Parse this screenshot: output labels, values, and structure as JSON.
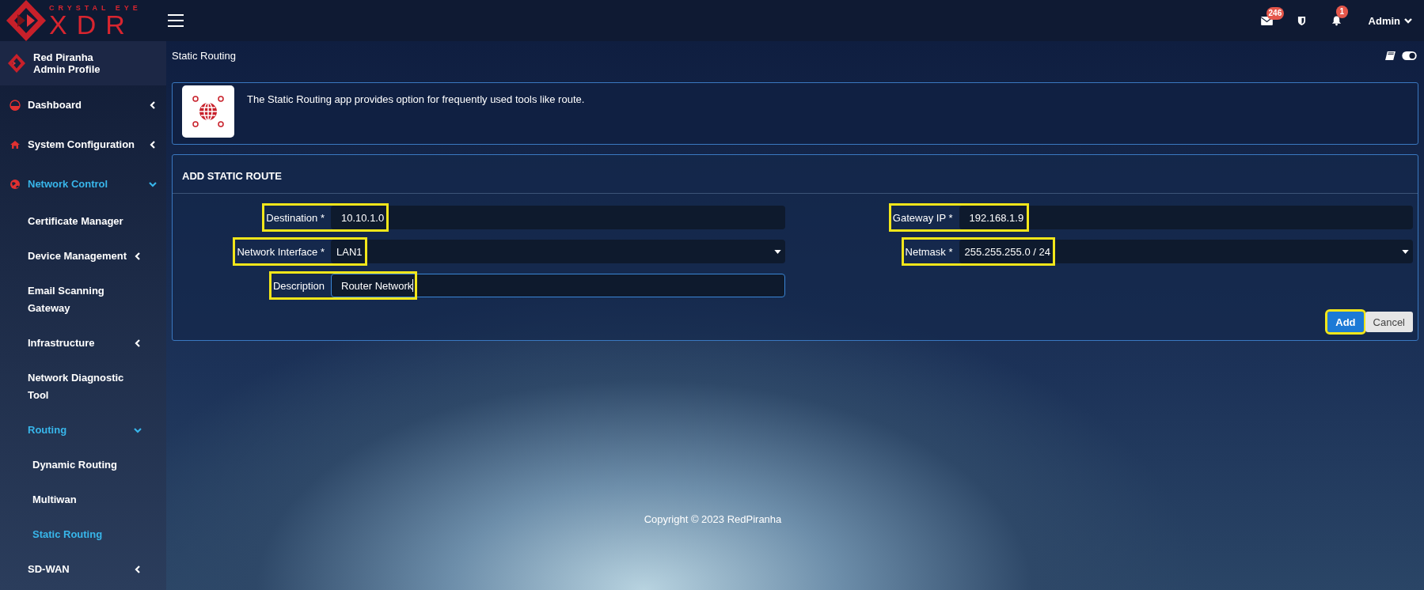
{
  "brand": {
    "tagline": "CRYSTAL EYE",
    "name": "XDR"
  },
  "top_bar": {
    "mail_count": "246",
    "alert_count": "1",
    "user": "Admin"
  },
  "profile": {
    "name": "Red Piranha",
    "role": "Admin Profile"
  },
  "sidebar": {
    "items": [
      {
        "label": "Dashboard",
        "expanded": false,
        "selected": false
      },
      {
        "label": "System Configuration",
        "expanded": false,
        "selected": false
      },
      {
        "label": "Network Control",
        "expanded": true,
        "selected": true,
        "children": [
          {
            "label": "Certificate Manager",
            "selected": false
          },
          {
            "label": "Device Management",
            "expanded": false,
            "selected": false
          },
          {
            "label": "Email Scanning Gateway",
            "selected": false
          },
          {
            "label": "Infrastructure",
            "expanded": false,
            "selected": false
          },
          {
            "label": "Network Diagnostic Tool",
            "selected": false
          },
          {
            "label": "Routing",
            "expanded": true,
            "selected": true,
            "children": [
              {
                "label": "Dynamic Routing",
                "selected": false
              },
              {
                "label": "Multiwan",
                "selected": false
              },
              {
                "label": "Static Routing",
                "selected": true
              }
            ]
          },
          {
            "label": "SD-WAN",
            "expanded": false,
            "selected": false
          }
        ]
      }
    ]
  },
  "page": {
    "title": "Static Routing"
  },
  "info": {
    "text": "The Static Routing app provides option for frequently used tools like route."
  },
  "form": {
    "title": "ADD STATIC ROUTE",
    "columns": [
      {
        "fields": [
          {
            "label": "Destination *",
            "value": "10.10.1.0",
            "kind": "text",
            "highlighted": true,
            "focused": false
          },
          {
            "label": "Network Interface *",
            "value": "LAN1",
            "kind": "select",
            "highlighted": true,
            "focused": false
          },
          {
            "label": "Description",
            "value": "Router Network",
            "kind": "text",
            "highlighted": true,
            "focused": true
          }
        ]
      },
      {
        "fields": [
          {
            "label": "Gateway IP *",
            "value": "192.168.1.9",
            "kind": "text",
            "highlighted": true,
            "focused": false
          },
          {
            "label": "Netmask *",
            "value": "255.255.255.0 / 24",
            "kind": "select",
            "highlighted": true,
            "focused": false
          }
        ]
      }
    ],
    "buttons": [
      {
        "label": "Add",
        "kind": "primary",
        "highlighted": true
      },
      {
        "label": "Cancel",
        "kind": "secondary",
        "highlighted": false
      }
    ]
  },
  "footer": {
    "text": "Copyright © 2023 RedPiranha"
  }
}
